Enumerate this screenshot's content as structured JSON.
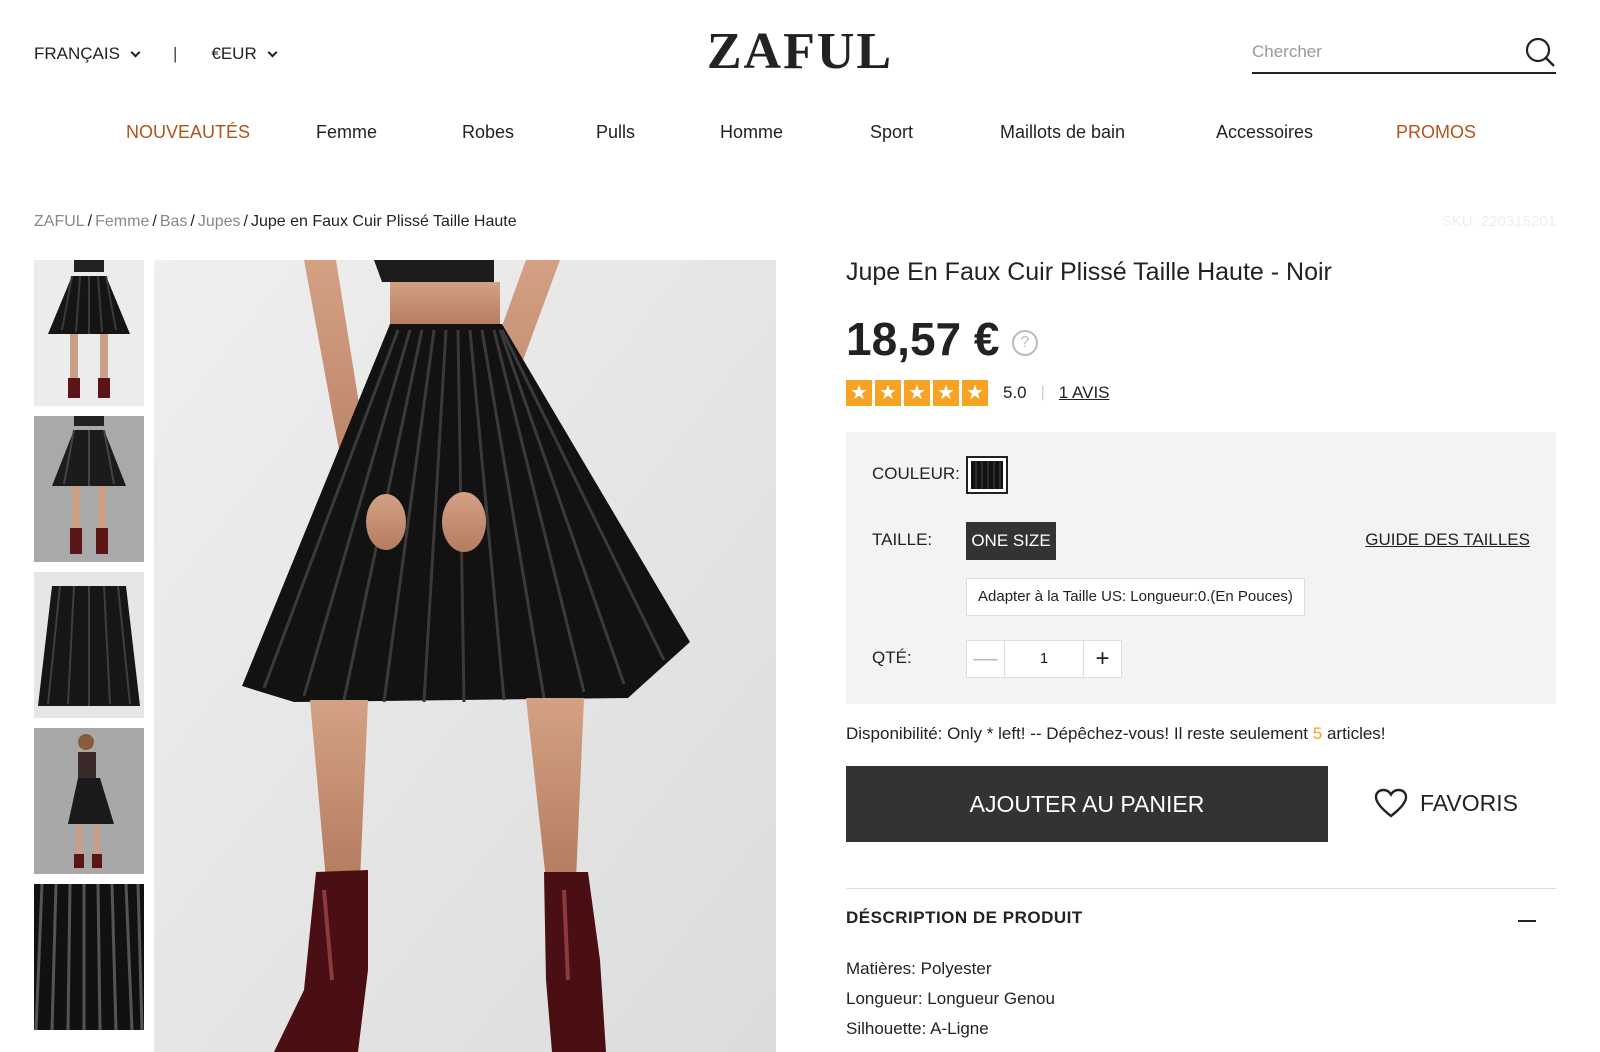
{
  "header": {
    "language": "FRANÇAIS",
    "separator": "|",
    "currency": "€EUR",
    "logo": "ZAFUL",
    "search_placeholder": "Chercher"
  },
  "nav": [
    "NOUVEAUTÉS",
    "Femme",
    "Robes",
    "Pulls",
    "Homme",
    "Sport",
    "Maillots de bain",
    "Accessoires",
    "PROMOS"
  ],
  "breadcrumb": {
    "items": [
      "ZAFUL",
      "Femme",
      "Bas",
      "Jupes"
    ],
    "current": "Jupe en Faux Cuir Plissé Taille Haute",
    "separator": "/",
    "sku": "SKU: 220315201"
  },
  "product": {
    "title": "Jupe En Faux Cuir Plissé Taille Haute - Noir",
    "price": "18,57 €",
    "price_help": "?",
    "rating": 5,
    "rating_value": "5.0",
    "rating_sep": "|",
    "reviews": "1 AVIS",
    "color_label": "COULEUR:",
    "size_label": "TAILLE:",
    "size_value": "ONE SIZE",
    "size_guide": "GUIDE DES TAILLES",
    "fit_note": "Adapter à la Taille US:   Longueur:0.(En Pouces)",
    "qty_label": "QTÉ:",
    "qty_minus": "—",
    "qty_plus": "+",
    "qty_value": "1",
    "availability_prefix": "Disponibilité: Only * left! -- Dépêchez-vous! Il reste seulement ",
    "availability_count": "5",
    "availability_suffix": " articles!",
    "add_to_cart": "AJOUTER AU PANIER",
    "favorites": "FAVORIS"
  },
  "description": {
    "heading": "DÉSCRIPTION DE PRODUIT",
    "lines": [
      "Matières: Polyester",
      "Longueur: Longueur Genou",
      "Silhouette: A-Ligne"
    ]
  },
  "colors": {
    "accent_nav": "#b5521b",
    "star": "#f6a323",
    "button": "#333333"
  }
}
